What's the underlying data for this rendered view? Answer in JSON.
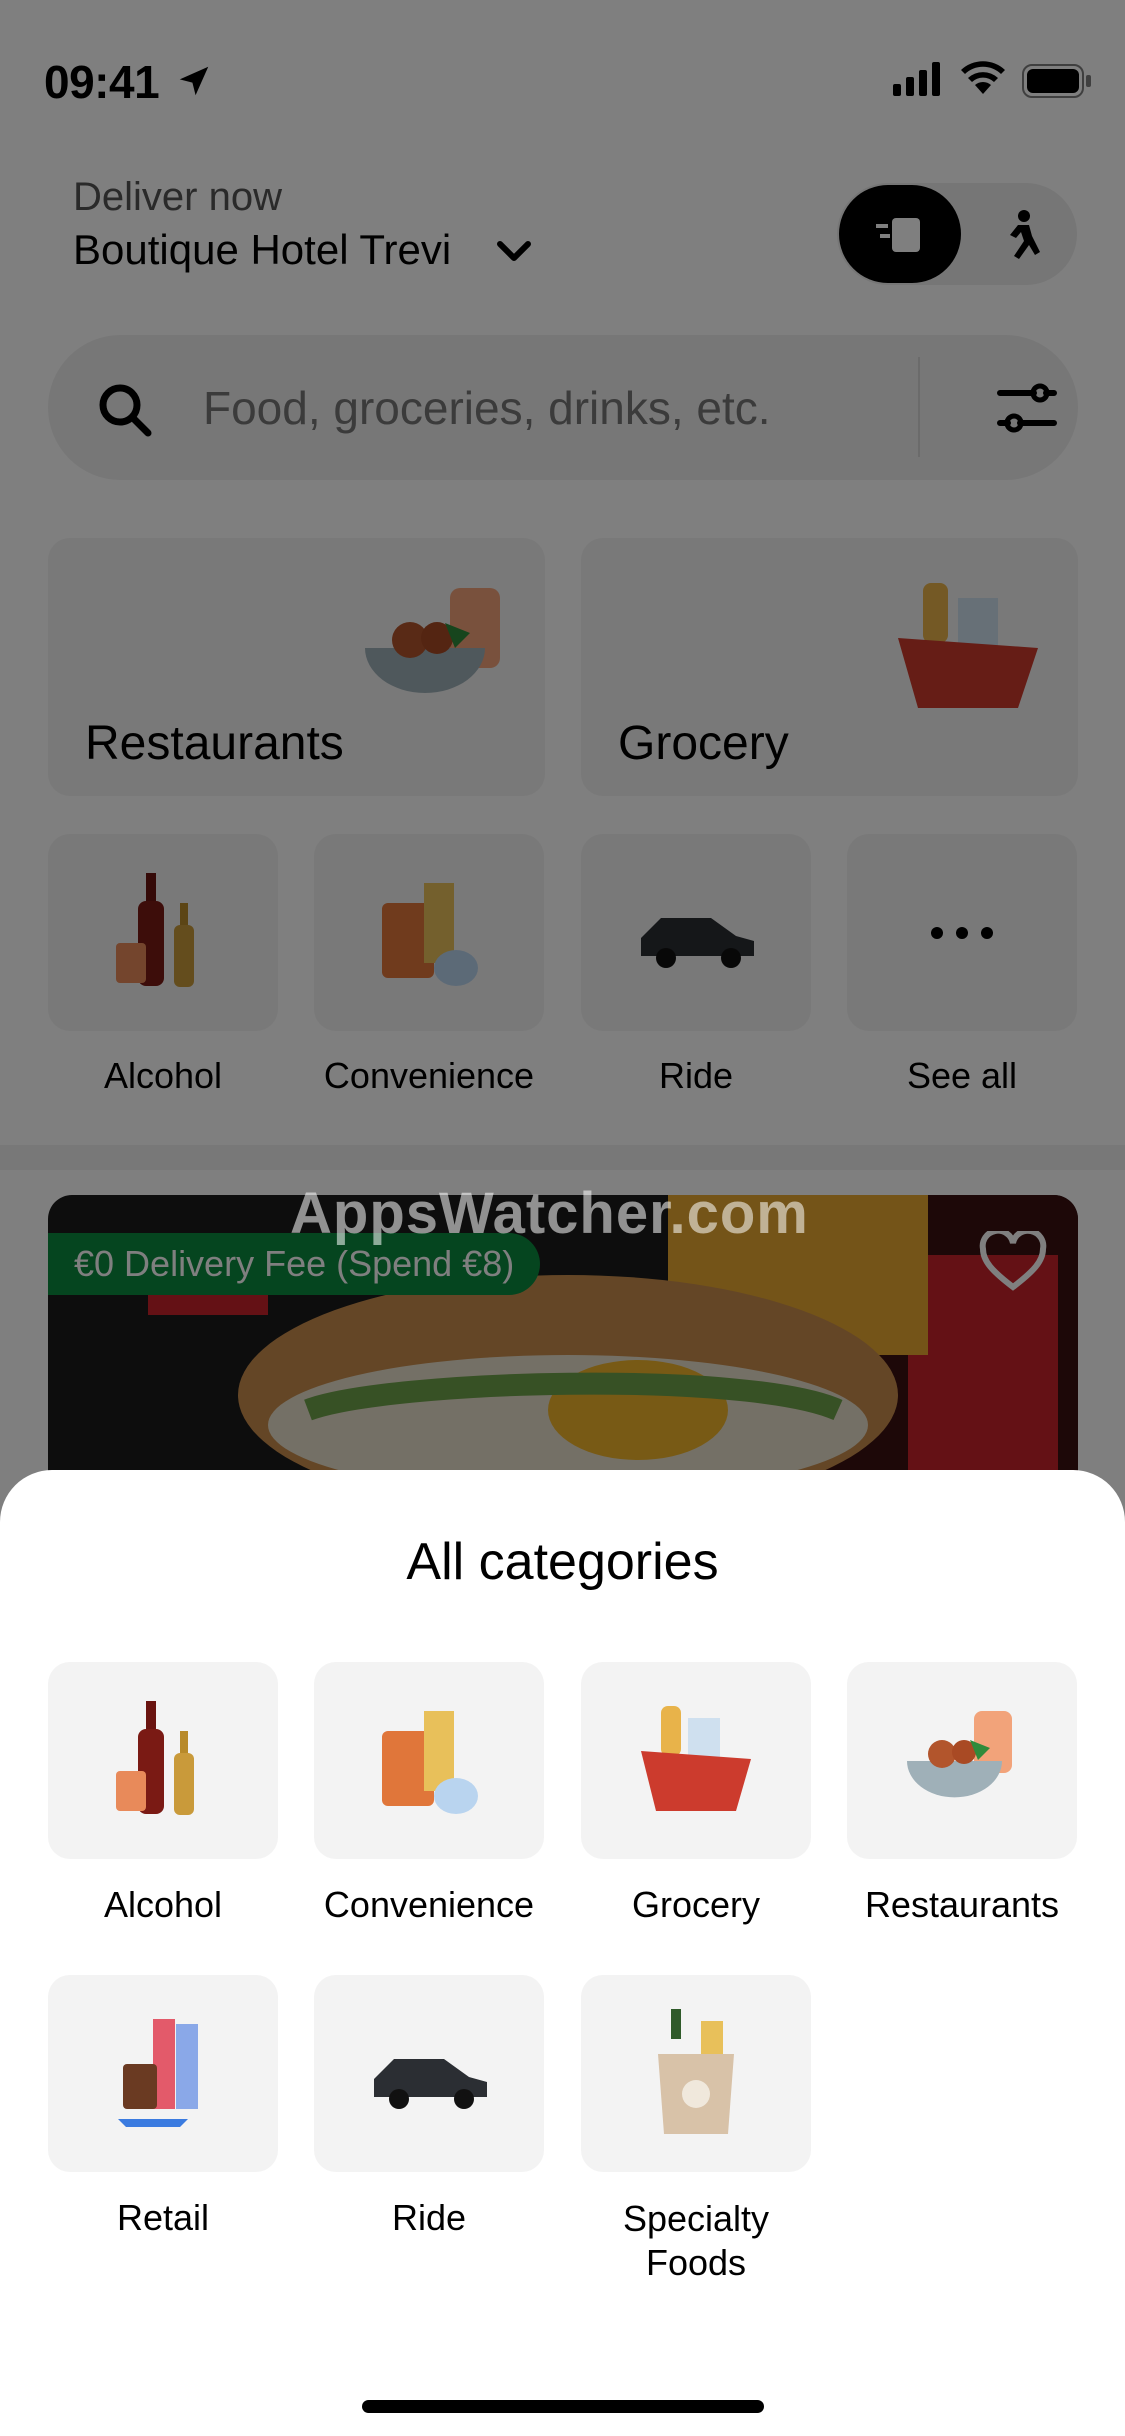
{
  "status_bar": {
    "time": "09:41"
  },
  "header": {
    "deliver_label": "Deliver now",
    "address": "Boutique Hotel Trevi"
  },
  "search": {
    "placeholder": "Food, groceries, drinks, etc."
  },
  "main_cards": [
    {
      "label": "Restaurants"
    },
    {
      "label": "Grocery"
    }
  ],
  "quick_tiles": [
    {
      "label": "Alcohol"
    },
    {
      "label": "Convenience"
    },
    {
      "label": "Ride"
    },
    {
      "label": "See all"
    }
  ],
  "promo": {
    "badge": "€0 Delivery Fee (Spend €8)"
  },
  "watermark": "AppsWatcher.com",
  "sheet": {
    "title": "All categories",
    "categories": [
      {
        "label": "Alcohol"
      },
      {
        "label": "Convenience"
      },
      {
        "label": "Grocery"
      },
      {
        "label": "Restaurants"
      },
      {
        "label": "Retail"
      },
      {
        "label": "Ride"
      },
      {
        "label": "Specialty Foods"
      }
    ]
  },
  "colors": {
    "promo_green": "#0b8a3e",
    "tile_bg": "#f3f3f3"
  }
}
